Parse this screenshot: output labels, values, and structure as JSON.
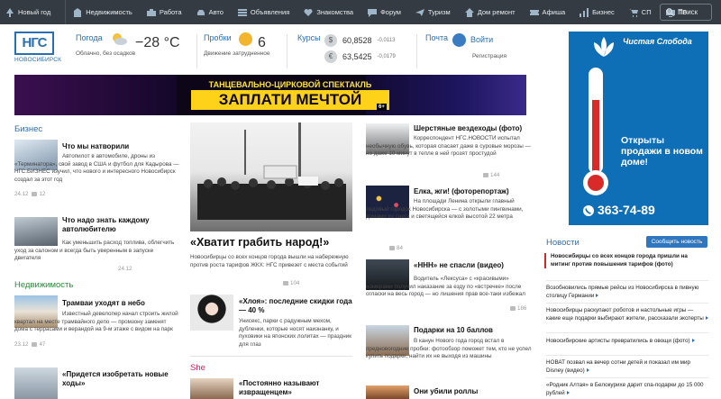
{
  "nav": {
    "items": [
      {
        "label": "Новый год",
        "icon": "tree-icon"
      },
      {
        "label": "Недвижимость",
        "icon": "building-icon"
      },
      {
        "label": "Работа",
        "icon": "briefcase-icon"
      },
      {
        "label": "Авто",
        "icon": "car-icon"
      },
      {
        "label": "Объявления",
        "icon": "list-icon"
      },
      {
        "label": "Знакомства",
        "icon": "heart-icon"
      },
      {
        "label": "Форум",
        "icon": "chat-icon"
      },
      {
        "label": "Туризм",
        "icon": "plane-icon"
      },
      {
        "label": "Дом ремонт",
        "icon": "house-icon"
      },
      {
        "label": "Афиша",
        "icon": "ticket-icon"
      },
      {
        "label": "Бизнес",
        "icon": "chart-icon"
      },
      {
        "label": "СП",
        "icon": "cart-icon"
      },
      {
        "label": "ТВ",
        "icon": "tv-icon"
      }
    ],
    "search_label": "Поиск"
  },
  "logo": {
    "text": "НГС",
    "city": "НОВОСИБИРСК"
  },
  "widgets": {
    "weather": {
      "title": "Погода",
      "temp": "−28 °C",
      "desc": "Облачно, без осадков"
    },
    "traffic": {
      "title": "Пробки",
      "score": "6",
      "desc": "Движение затрудненное"
    },
    "currency": {
      "title": "Курсы",
      "usd": {
        "symbol": "$",
        "value": "60,8528",
        "change": "-0,0113"
      },
      "eur": {
        "symbol": "€",
        "value": "63,5425",
        "change": "-0,0179"
      }
    },
    "mail": {
      "title": "Почта",
      "login": "Войти",
      "register": "Регистрация"
    }
  },
  "banner": {
    "line1": "ТАНЦЕВАЛЬНО-ЦИРКОВОЙ СПЕКТАКЛЬ",
    "line2": "ЗАПЛАТИ МЕЧТОЙ",
    "age": "6+"
  },
  "ad_right": {
    "brand": "Чистая Слобода",
    "slogan": "Открыты продажи в новом доме!",
    "phone": "363-74-89"
  },
  "sections": {
    "business": "Бизнес",
    "realty": "Недвижимость",
    "she": "She"
  },
  "business": [
    {
      "title": "Что мы натворили",
      "desc": "Автопилот в автомобиле, дроны из «Терминатора», свой завод в США и футбол для Кадырова — НГС.БИЗНЕС изучил, что нового и интересного Новосибирск создал за этот год",
      "date": "24.12",
      "comments": "12"
    },
    {
      "title": "Что надо знать каждому автолюбителю",
      "desc": "Как уменьшить расход топлива, облегчить уход за салоном и всегда быть уверенным в запуске двигателя",
      "date": "24.12"
    }
  ],
  "realty": [
    {
      "title": "Трамваи уходят в небо",
      "desc": "Известный девелопер начал строить жилой квартал на месте трамвайного депо — промзону заменят дома с террасами и верандой на 9-м этаже с видом на парк",
      "date": "23.12",
      "comments": "47"
    },
    {
      "title": "«Придется изобретать новые ходы»"
    }
  ],
  "main": {
    "title": "«Хватит грабить народ!»",
    "desc": "Новосибирцы со всех концов города вышли на набережную против роста тарифов ЖКХ: НГС привезет с места событий",
    "comments": "104"
  },
  "she_story": {
    "title": "«Хлоя»: последние скидки года — 40 %",
    "desc": "Унисекс, парки с радужным мехом, дубленки, которые носят наизнанку, и пуховики на японских лолитах — праздник для глаз"
  },
  "she_next": {
    "title": "«Постоянно называют извращенцем»"
  },
  "mid": [
    {
      "title": "Шерстяные вездеходы (фото)",
      "desc": "Корреспондент НГС.НОВОСТИ испытал необычную обувь, которая спасает даже в суровые морозы — но даже 10 минут в тепле в ней грозят простудой",
      "comments": "144"
    },
    {
      "title": "Елка, жги! (фоторепортаж)",
      "desc": "На площади Ленина открыли главный ледовый городок Новосибирска — с золотыми пингвинами, домами из снега и светящейся елкой высотой 22 метра",
      "comments": "84"
    },
    {
      "title": "«HHH» не спасли (видео)",
      "desc": "Водитель «Лексуса» с «красивыми» номерами получил наказание за езду по «встречке» после огласки на весь город — но лишения прав все-таки избежал",
      "comments": "186"
    },
    {
      "title": "Подарки на 10 баллов",
      "desc": "В канун Нового года город встал в предновогодние пробки: фотообзор поможет тем, кто не успел купить подарки, найти их не выходя из машины"
    },
    {
      "title": "Они убили роллы"
    }
  ],
  "news": {
    "title": "Новости",
    "report_button": "Сообщить новость",
    "items": [
      {
        "text": "Новосибирцы со всех концов города пришли на митинг против повышения тарифов (фото)",
        "hot": true
      },
      {
        "text": "Возобновились прямые рейсы из Новосибирска в пивную столицу Германии"
      },
      {
        "text": "Новосибирцы раскупают роботов и настольные игры — какие еще подарки выбирают жители, рассказали эксперты"
      },
      {
        "text": "Новосибирские артисты превратились в овощи (фото)"
      },
      {
        "text": "НОВАТ позвал на вечер сотни детей и показал им мир Disney (видео)"
      },
      {
        "text": "«Родник Алтая» в Белокурихе дарит спа-подарки до 15 000 рублей"
      }
    ]
  }
}
